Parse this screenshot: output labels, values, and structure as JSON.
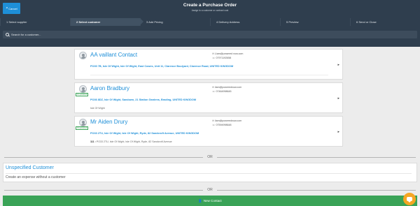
{
  "header": {
    "cancel_label": "Cancel",
    "title": "Create a Purchase Order",
    "subtitle": "Assign to a customer or contract cost"
  },
  "steps": [
    {
      "label": "1 Select supplier"
    },
    {
      "label": "2 Select customer"
    },
    {
      "label": "3 Add Pricing"
    },
    {
      "label": "4 Delivery Address"
    },
    {
      "label": "5 Preview"
    },
    {
      "label": "6 Send or Close"
    }
  ],
  "search": {
    "placeholder": "Search for a customer..."
  },
  "contacts": [
    {
      "name": "AA vaillant Contact",
      "email": "Liam@powered now.com",
      "phone": "07971192658",
      "address": "PO30 7B, Isle Of Wight, Isle Of Wight, East Cowes, Unit 11, Clarence Boulyard, Clarence Road, UNITED KINGDOM",
      "extra_label": "",
      "extra_value": "",
      "badge": ""
    },
    {
      "name": "Aaron Bradbury",
      "email": "liam@powerednow.com",
      "phone": "07464998645",
      "address": "PO36 8DZ, Isle Of Wight, Sandown, 21 Station Gardens, Brading, UNITED KINGDOM",
      "extra_label": "",
      "extra_value": "Isle Of Wight",
      "badge": "On powered"
    },
    {
      "name": "Mr Aiden Drury",
      "email": "liam@powerednow.com",
      "phone": "07594998648",
      "address": "PO33 2TU, Isle Of Wight, Isle Of Wight, Ryde, 82 Sandcroft Avenue, UNITED KINGDOM",
      "extra_label": "111 :",
      "extra_value": "PO33 2TU, Isle Of Wight, Isle Of Wight, Ryde, 82 Sandcroft Avenue",
      "badge": "On powered"
    }
  ],
  "or_label": "OR",
  "unspecified": {
    "title": "Unspecified Customer",
    "description": "Create an expense without a customer"
  },
  "new_contact_label": "New Contact"
}
